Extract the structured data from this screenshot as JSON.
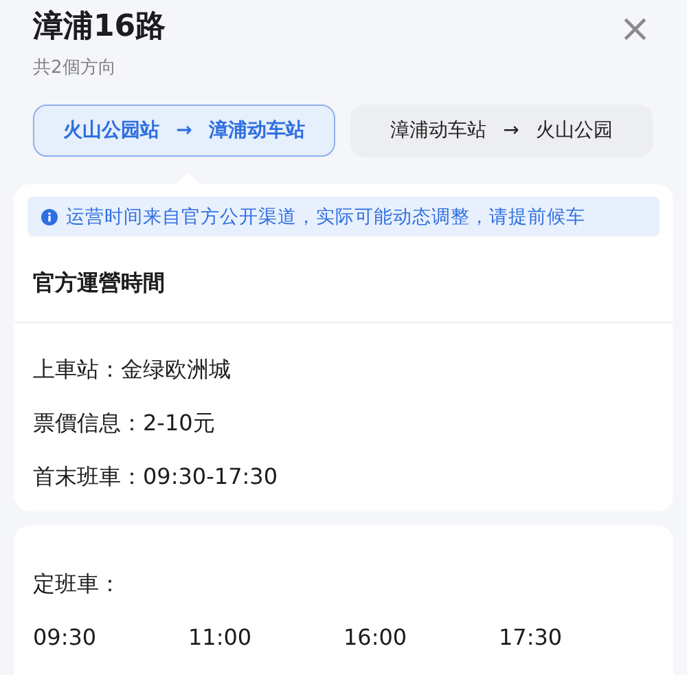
{
  "header": {
    "title": "漳浦16路",
    "subtitle": "共2個方向",
    "close": "×"
  },
  "directions": [
    {
      "from": "火山公园站",
      "arrow": "→",
      "to": "漳浦动车站",
      "selected": true
    },
    {
      "from": "漳浦动车站",
      "arrow": "→",
      "to": "火山公园",
      "selected": false
    }
  ],
  "notice": "运营时间来自官方公开渠道，实际可能动态调整，请提前候车",
  "official": {
    "heading": "官方運營時間",
    "rows": [
      "上車站：金绿欧洲城",
      "票價信息：2-10元",
      "首末班車：09:30-17:30"
    ]
  },
  "schedule": {
    "label": "定班車：",
    "times": [
      "09:30",
      "11:00",
      "16:00",
      "17:30"
    ]
  }
}
